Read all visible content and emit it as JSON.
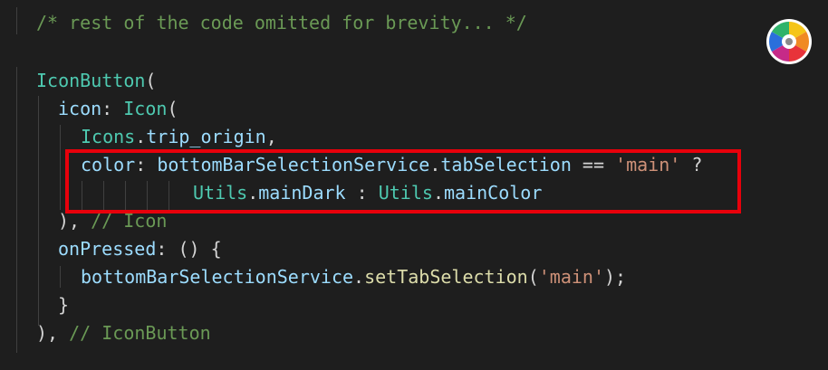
{
  "editor": {
    "lines": [
      {
        "tokens": [
          {
            "t": "/* rest of the code omitted for brevity... */",
            "c": "comment"
          }
        ]
      },
      {
        "tokens": []
      },
      {
        "tokens": [
          {
            "t": "IconButton",
            "c": "class"
          },
          {
            "t": "(",
            "c": "punct"
          }
        ]
      },
      {
        "tokens": [
          {
            "t": "icon",
            "c": "prop"
          },
          {
            "t": ": ",
            "c": "punct"
          },
          {
            "t": "Icon",
            "c": "class"
          },
          {
            "t": "(",
            "c": "punct"
          }
        ]
      },
      {
        "tokens": [
          {
            "t": "Icons",
            "c": "class"
          },
          {
            "t": ".",
            "c": "punct"
          },
          {
            "t": "trip_origin",
            "c": "prop"
          },
          {
            "t": ",",
            "c": "punct"
          }
        ]
      },
      {
        "tokens": [
          {
            "t": "color",
            "c": "prop"
          },
          {
            "t": ": ",
            "c": "punct"
          },
          {
            "t": "bottomBarSelectionService",
            "c": "prop"
          },
          {
            "t": ".",
            "c": "punct"
          },
          {
            "t": "tabSelection",
            "c": "prop"
          },
          {
            "t": " == ",
            "c": "op"
          },
          {
            "t": "'main'",
            "c": "string"
          },
          {
            "t": " ?",
            "c": "op"
          }
        ]
      },
      {
        "tokens": [
          {
            "t": "Utils",
            "c": "class"
          },
          {
            "t": ".",
            "c": "punct"
          },
          {
            "t": "mainDark",
            "c": "prop"
          },
          {
            "t": " : ",
            "c": "op"
          },
          {
            "t": "Utils",
            "c": "class"
          },
          {
            "t": ".",
            "c": "punct"
          },
          {
            "t": "mainColor",
            "c": "prop"
          }
        ]
      },
      {
        "tokens": [
          {
            "t": "), ",
            "c": "punct"
          },
          {
            "t": "// Icon",
            "c": "comment"
          }
        ]
      },
      {
        "tokens": [
          {
            "t": "onPressed",
            "c": "prop"
          },
          {
            "t": ": () {",
            "c": "punct"
          }
        ]
      },
      {
        "tokens": [
          {
            "t": "bottomBarSelectionService",
            "c": "prop"
          },
          {
            "t": ".",
            "c": "punct"
          },
          {
            "t": "setTabSelection",
            "c": "func"
          },
          {
            "t": "(",
            "c": "punct"
          },
          {
            "t": "'main'",
            "c": "string"
          },
          {
            "t": ");",
            "c": "punct"
          }
        ]
      },
      {
        "tokens": [
          {
            "t": "}",
            "c": "punct"
          }
        ]
      },
      {
        "tokens": [
          {
            "t": "), ",
            "c": "punct"
          },
          {
            "t": "// IconButton",
            "c": "comment"
          }
        ]
      }
    ]
  },
  "colors": {
    "background": "#1e1e1e",
    "highlight_border": "#e8000b"
  },
  "widget": {
    "icon": "color-wheel-icon"
  }
}
